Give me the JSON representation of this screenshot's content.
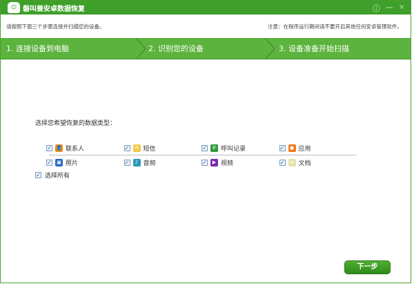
{
  "title": "磐叫兽安卓数据恢复",
  "window_controls": [
    "ⓘ",
    "—",
    "✕"
  ],
  "info_left": "请按照下面三个步骤连接并扫描您的设备。",
  "info_right": "注意：在程序运行期间请不要开启其他任何安卓管理软件。",
  "steps": [
    "1. 连接设备到电脑",
    "2. 识别您的设备",
    "3. 设备准备开始扫描"
  ],
  "select_label": "选择您希望恢复的数据类型：",
  "types": [
    {
      "label": "联系人",
      "icon": "contacts-icon",
      "color": "#f08a1c",
      "glyph": "👤",
      "checked": true
    },
    {
      "label": "短信",
      "icon": "sms-icon",
      "color": "#f5c842",
      "glyph": "✉",
      "checked": true
    },
    {
      "label": "呼叫记录",
      "icon": "call-log-icon",
      "color": "#2e9a3a",
      "glyph": "✆",
      "checked": true
    },
    {
      "label": "应用",
      "icon": "app-icon",
      "color": "#f07a1c",
      "glyph": "●",
      "checked": true
    },
    {
      "label": "照片",
      "icon": "photo-icon",
      "color": "#2a6ac8",
      "glyph": "▣",
      "checked": true
    },
    {
      "label": "音频",
      "icon": "audio-icon",
      "color": "#2a9ab8",
      "glyph": "♪",
      "checked": true
    },
    {
      "label": "视频",
      "icon": "video-icon",
      "color": "#7a2ab0",
      "glyph": "▶",
      "checked": true
    },
    {
      "label": "文档",
      "icon": "document-icon",
      "color": "#e8e0b0",
      "glyph": "≡",
      "checked": true
    }
  ],
  "select_all": "选择所有",
  "next_button": "下一步"
}
